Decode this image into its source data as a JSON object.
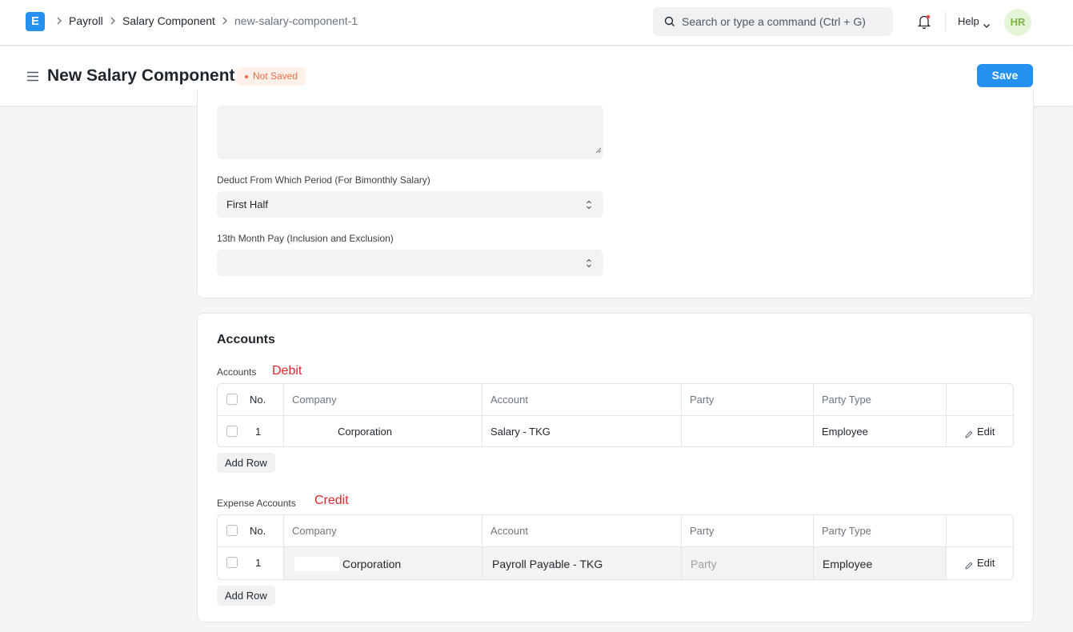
{
  "navbar": {
    "logo": "E",
    "breadcrumbs": [
      "Payroll",
      "Salary Component",
      "new-salary-component-1"
    ],
    "search_placeholder": "Search or type a command (Ctrl + G)",
    "help_label": "Help",
    "avatar_initials": "HR"
  },
  "page": {
    "title": "New Salary Component",
    "status": "Not Saved",
    "save_label": "Save"
  },
  "form": {
    "deduct_period_label": "Deduct From Which Period (For Bimonthly Salary)",
    "deduct_period_value": "First Half",
    "thirteenth_label": "13th Month Pay (Inclusion and Exclusion)",
    "thirteenth_value": ""
  },
  "accounts_section": {
    "title": "Accounts",
    "debit_table": {
      "label": "Accounts",
      "annotation": "Debit",
      "headers": [
        "No.",
        "Company",
        "Account",
        "Party",
        "Party Type"
      ],
      "rows": [
        {
          "no": "1",
          "company": "Corporation",
          "account": "Salary - TKG",
          "party": "",
          "party_type": "Employee"
        }
      ],
      "edit_label": "Edit",
      "add_row_label": "Add Row"
    },
    "credit_table": {
      "label": "Expense Accounts",
      "annotation": "Credit",
      "headers": [
        "No.",
        "Company",
        "Account",
        "Party",
        "Party Type"
      ],
      "rows": [
        {
          "no": "1",
          "company": "Corporation",
          "account": "Payroll Payable - TKG",
          "party_placeholder": "Party",
          "party_type": "Employee"
        }
      ],
      "edit_label": "Edit",
      "add_row_label": "Add Row"
    }
  },
  "colors": {
    "primary": "#2490ef",
    "annotation_red": "#e0262b",
    "not_saved": "#e86c4a"
  }
}
